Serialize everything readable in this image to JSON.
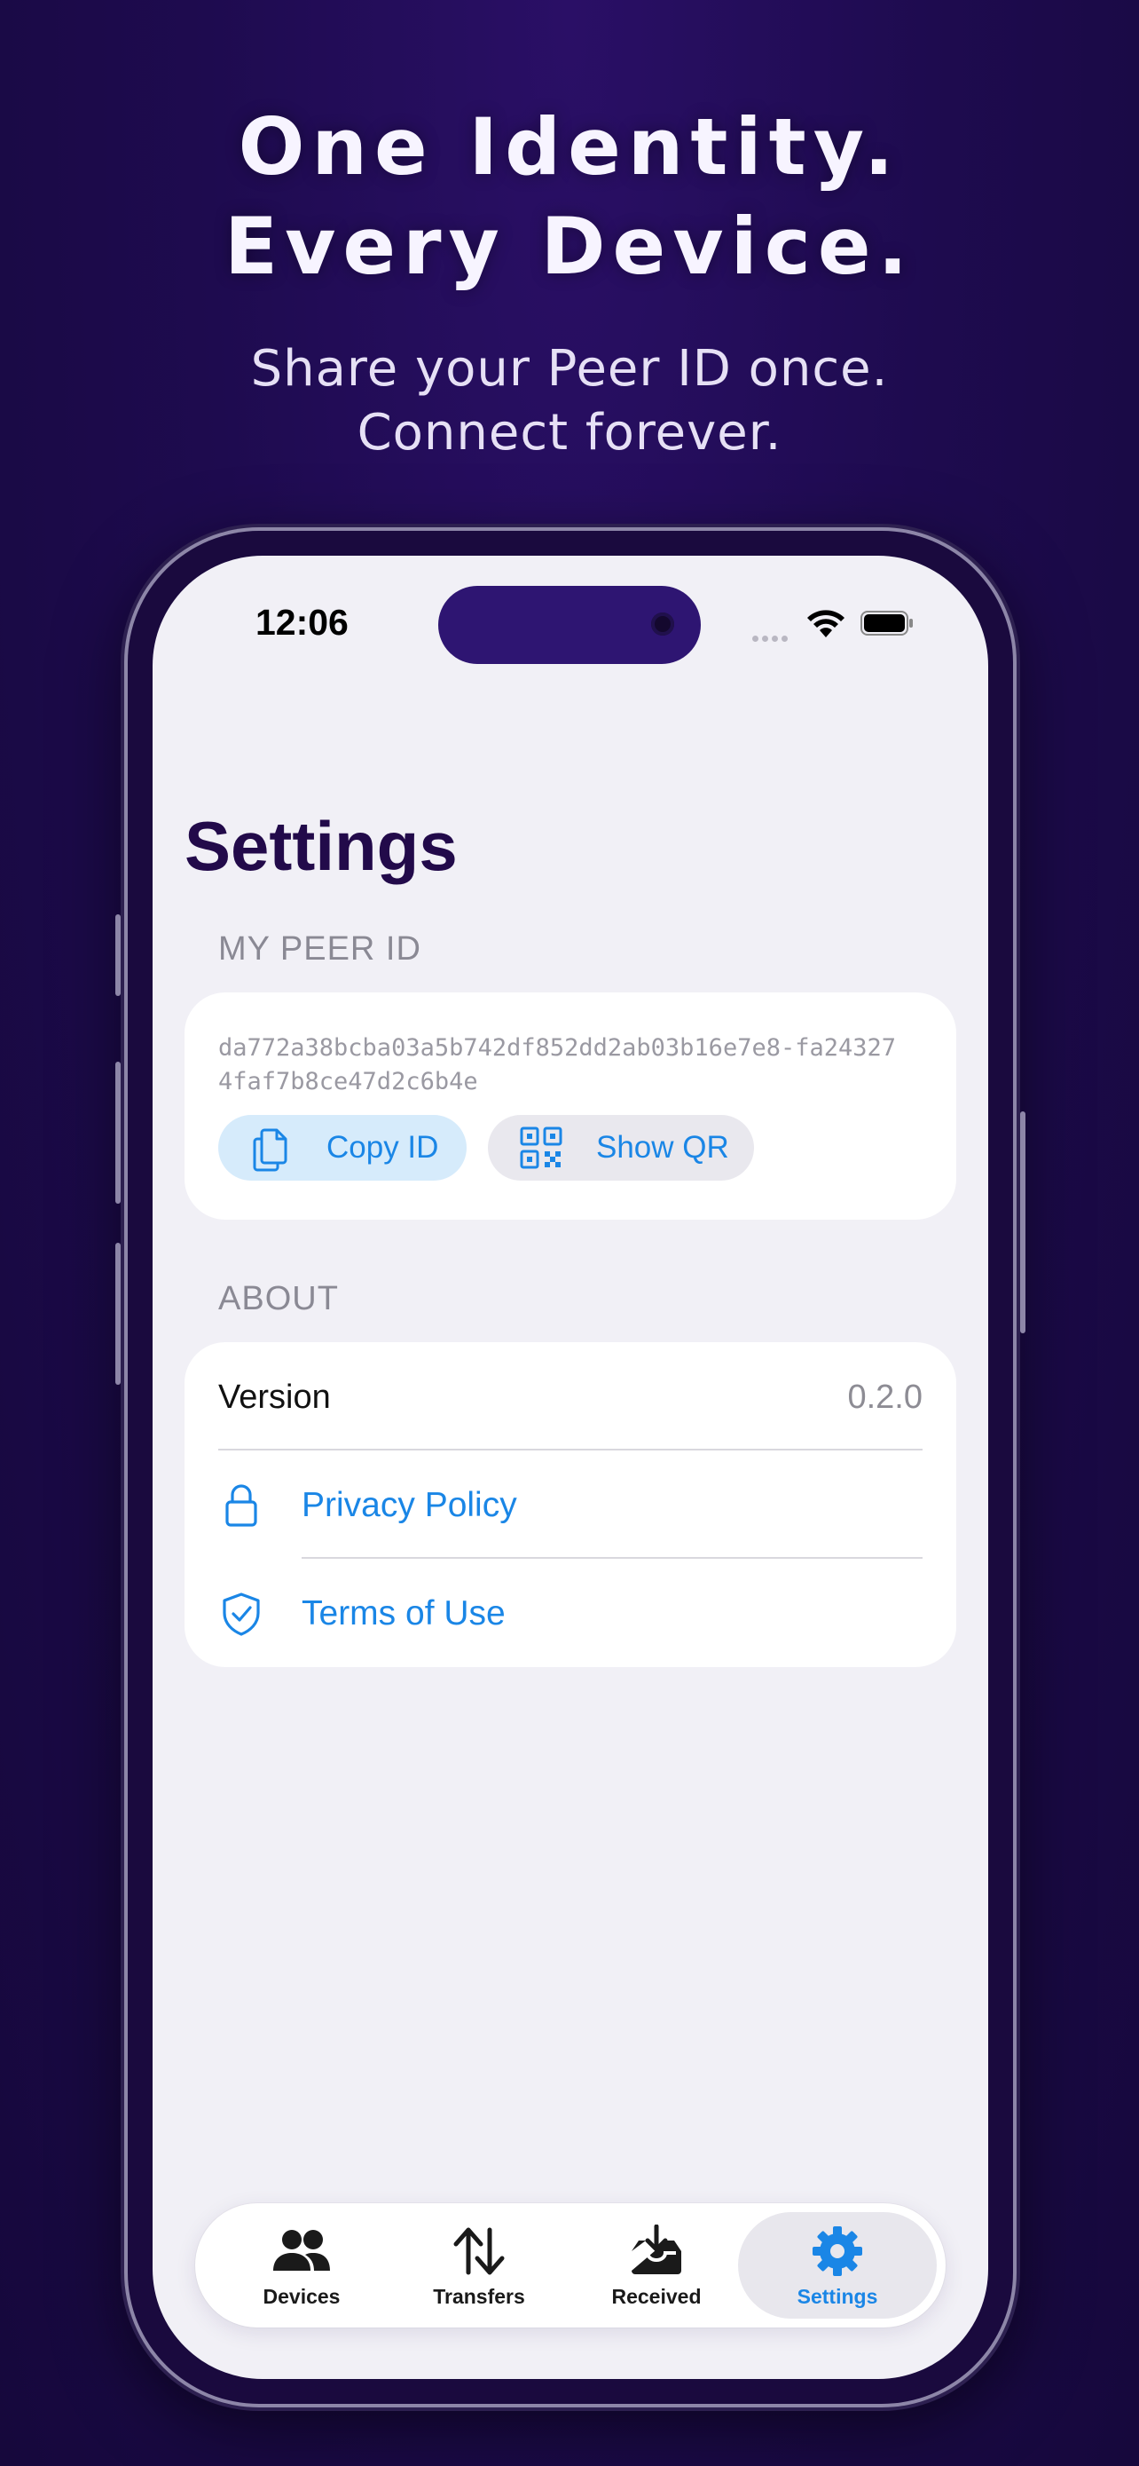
{
  "marketing": {
    "headline_line1": "One Identity.",
    "headline_line2": "Every Device.",
    "subline_line1": "Share your Peer ID once.",
    "subline_line2": "Connect forever."
  },
  "status_bar": {
    "time": "12:06",
    "icons": [
      "signal-dots-icon",
      "wifi-icon",
      "battery-icon"
    ]
  },
  "page": {
    "title": "Settings"
  },
  "peer_section": {
    "label": "MY PEER ID",
    "peer_id": "da772a38bcba03a5b742df852dd2ab03b16e7e8-fa243274faf7b8ce47d2c6b4e",
    "copy_label": "Copy ID",
    "copy_icon": "document-copy-icon",
    "qr_label": "Show QR",
    "qr_icon": "qr-code-icon"
  },
  "about_section": {
    "label": "ABOUT",
    "version_label": "Version",
    "version_value": "0.2.0",
    "privacy_label": "Privacy Policy",
    "privacy_icon": "lock-icon",
    "terms_label": "Terms of Use",
    "terms_icon": "shield-check-icon"
  },
  "tabbar": {
    "tabs": [
      {
        "label": "Devices",
        "icon": "people-icon",
        "active": false
      },
      {
        "label": "Transfers",
        "icon": "arrows-up-down-icon",
        "active": false
      },
      {
        "label": "Received",
        "icon": "inbox-download-icon",
        "active": false
      },
      {
        "label": "Settings",
        "icon": "gear-icon",
        "active": true
      }
    ]
  },
  "colors": {
    "accent": "#1a86e6",
    "background": "#1e0b4f",
    "title": "#220a4a",
    "screen": "#f1f0f6"
  }
}
